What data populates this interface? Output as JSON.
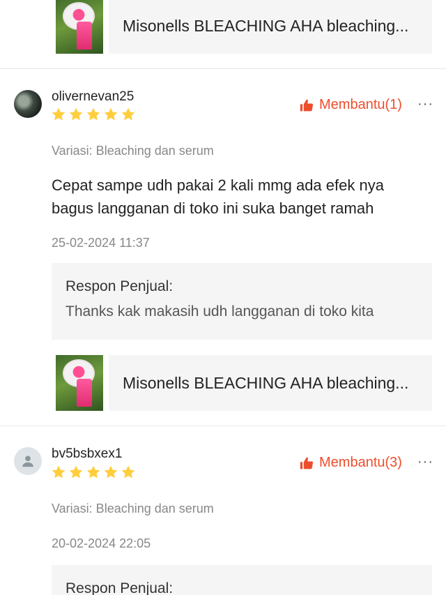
{
  "top_product": {
    "name": "Misonells BLEACHING AHA bleaching..."
  },
  "reviews": [
    {
      "username": "olivernevan25",
      "rating": 5,
      "helpful_label": "Membantu(1)",
      "more_label": "···",
      "variation": "Variasi: Bleaching dan serum",
      "comment_lines": [
        "Cepat sampe udh pakai 2 kali mmg ada efek nya",
        "bagus langganan di toko ini suka banget ramah"
      ],
      "timestamp": "25-02-2024 11:37",
      "seller_title": "Respon Penjual:",
      "seller_response": "Thanks kak makasih udh langganan di toko kita",
      "product_name": "Misonells BLEACHING AHA bleaching..."
    },
    {
      "username": "bv5bsbxex1",
      "rating": 5,
      "helpful_label": "Membantu(3)",
      "more_label": "···",
      "variation": "Variasi: Bleaching dan serum",
      "timestamp": "20-02-2024 22:05",
      "seller_title": "Respon Penjual:"
    }
  ],
  "colors": {
    "accent": "#ee4d2d",
    "star": "#ffce3d"
  },
  "icons": {
    "helpful": "thumbs-up-icon",
    "more": "more-dots-icon",
    "star": "star-icon",
    "default_avatar": "user-icon"
  }
}
